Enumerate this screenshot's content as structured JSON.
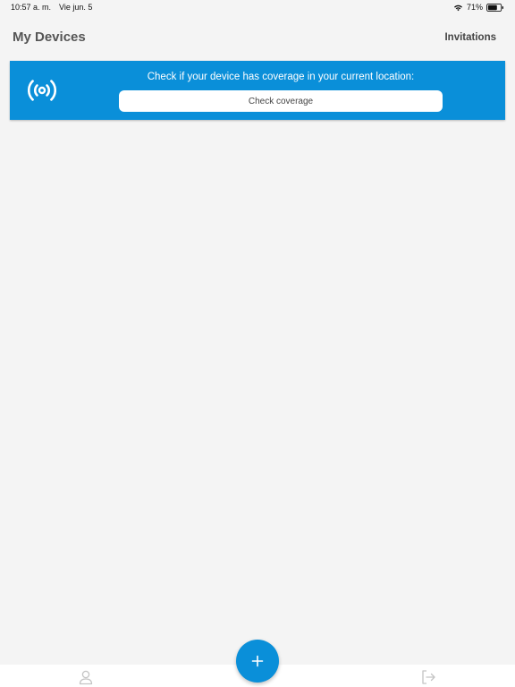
{
  "status_bar": {
    "time": "10:57 a. m.",
    "date": "Vie jun. 5",
    "battery": "71%"
  },
  "header": {
    "title": "My Devices",
    "invitations_label": "Invitations"
  },
  "coverage_banner": {
    "message": "Check if your device has coverage in your current location:",
    "button_label": "Check coverage",
    "icon": "broadcast-icon"
  },
  "tab_bar": {
    "left_icon": "profile-icon",
    "right_icon": "logout-icon"
  },
  "fab": {
    "icon": "plus-icon"
  },
  "colors": {
    "accent": "#0a8fd9",
    "background": "#f4f4f4",
    "title_text": "#555555"
  }
}
